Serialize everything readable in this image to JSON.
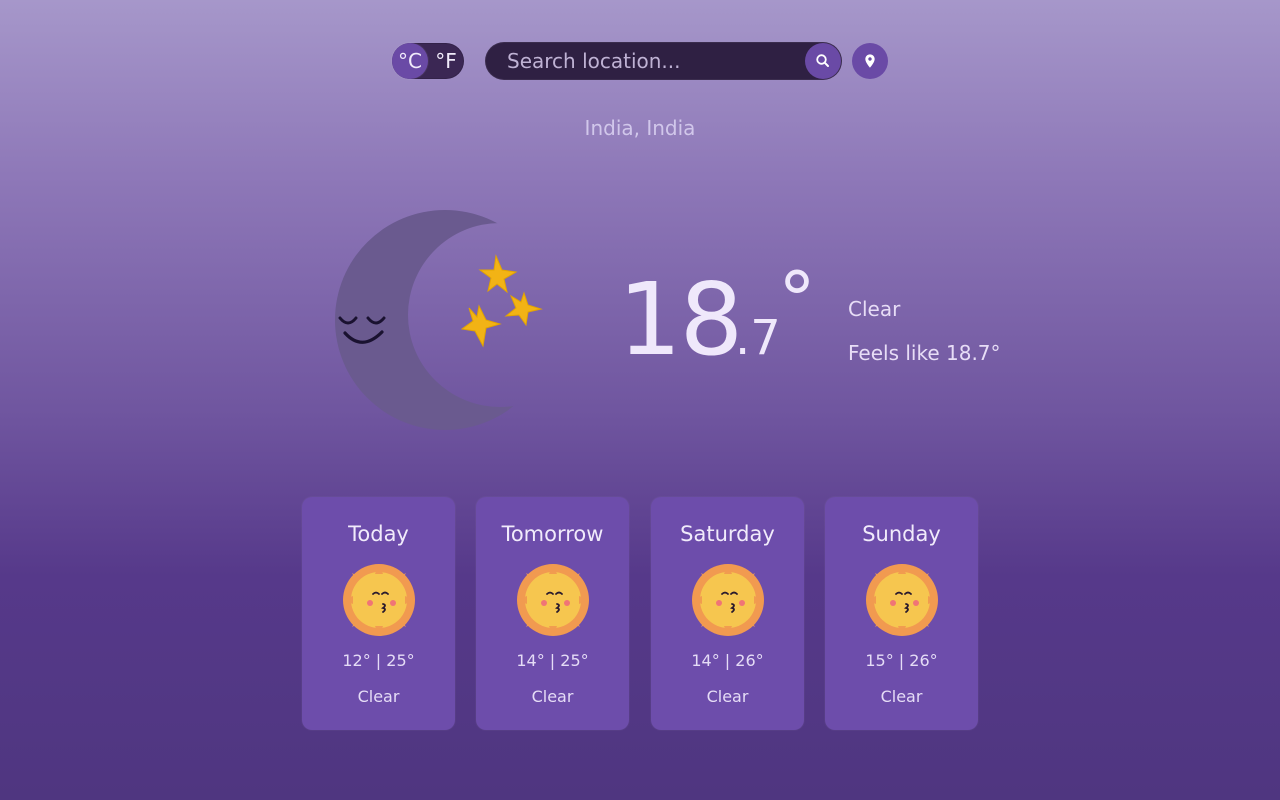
{
  "top_bar": {
    "unit_toggle": {
      "celsius_label": "°C",
      "fahrenheit_label": "°F",
      "active": "celsius"
    },
    "search": {
      "placeholder": "Search location...",
      "value": ""
    },
    "buttons": {
      "search_icon": "search-icon",
      "location_icon": "location-pin-icon"
    }
  },
  "current": {
    "location": "India, India",
    "temp_integer": "18",
    "temp_decimal": ".7",
    "degree_symbol": "°",
    "condition": "Clear",
    "feels_like": "Feels like 18.7°",
    "icon": "moon-with-stars-icon"
  },
  "forecast": [
    {
      "day": "Today",
      "temps": "12° | 25°",
      "condition": "Clear",
      "icon": "sun-icon"
    },
    {
      "day": "Tomorrow",
      "temps": "14° | 25°",
      "condition": "Clear",
      "icon": "sun-icon"
    },
    {
      "day": "Saturday",
      "temps": "14° | 26°",
      "condition": "Clear",
      "icon": "sun-icon"
    },
    {
      "day": "Sunday",
      "temps": "15° | 26°",
      "condition": "Clear",
      "icon": "sun-icon"
    }
  ],
  "colors": {
    "accent": "#6a4aa6",
    "search_bg": "#2f2043",
    "card_bg": "#6d4dab",
    "moon": "#6a5a8f",
    "star": "#f2b315",
    "sun": "#f6c64f",
    "sun_rays": "#f19a50"
  }
}
